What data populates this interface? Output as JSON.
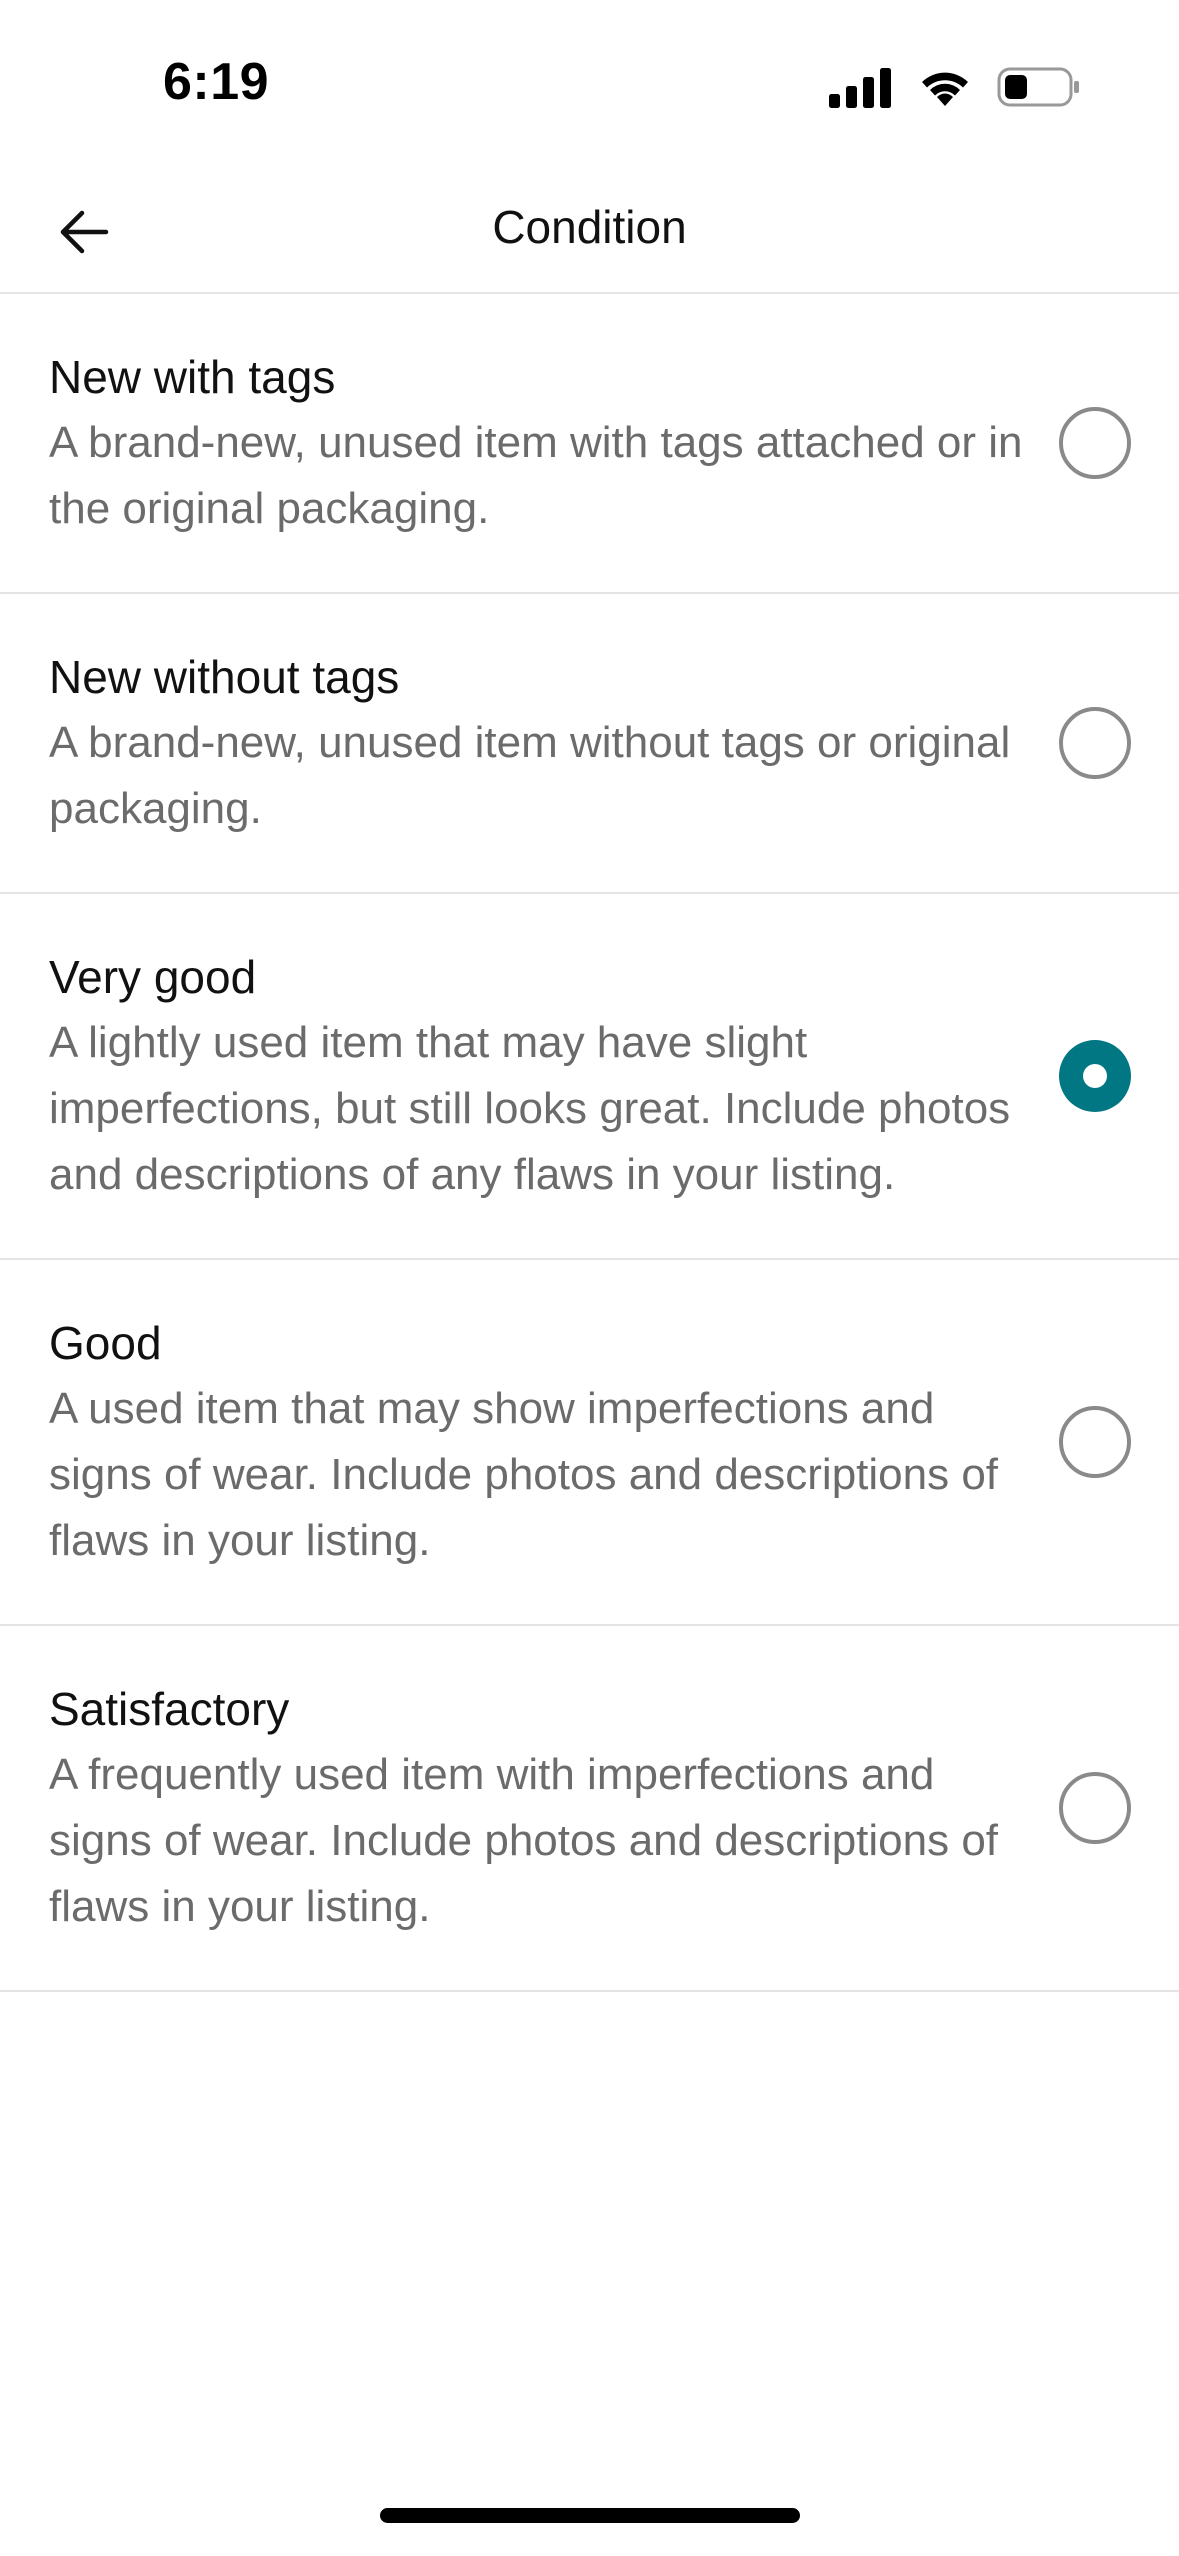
{
  "status_bar": {
    "time": "6:19",
    "icons": [
      "cellular-signal-icon",
      "wifi-icon",
      "battery-icon"
    ]
  },
  "header": {
    "title": "Condition",
    "back_icon": "arrow-left-icon"
  },
  "colors": {
    "accent": "#007782",
    "divider": "#e4e4e4",
    "description_text": "#6b6b6b"
  },
  "options": [
    {
      "title": "New with tags",
      "description": "A brand-new, unused item with tags attached or in the original packaging.",
      "selected": false
    },
    {
      "title": "New without tags",
      "description": "A brand-new, unused item without tags or original packaging.",
      "selected": false
    },
    {
      "title": "Very good",
      "description": "A lightly used item that may have slight imperfections, but still looks great. Include photos and descriptions of any flaws in your listing.",
      "selected": true
    },
    {
      "title": "Good",
      "description": "A used item that may show imperfections and signs of wear. Include photos and descriptions of flaws in your listing.",
      "selected": false
    },
    {
      "title": "Satisfactory",
      "description": "A frequently used item with imperfections and signs of wear. Include photos and descriptions of flaws in your listing.",
      "selected": false
    }
  ]
}
